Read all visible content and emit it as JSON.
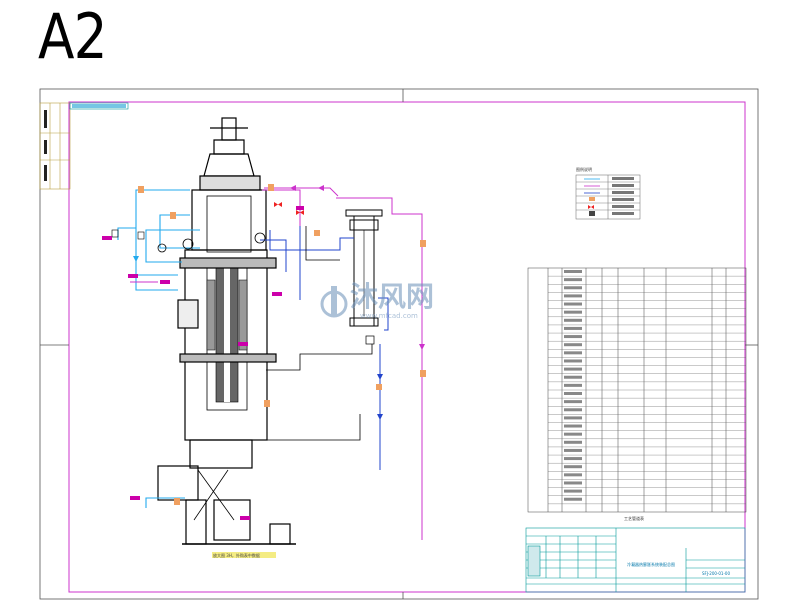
{
  "sheet": {
    "size_label": "A2"
  },
  "colors": {
    "border": "#cc33cc",
    "structure": "#000000",
    "pipe_cyan": "#22aaee",
    "pipe_magenta": "#cc33cc",
    "pipe_blue": "#2244cc",
    "valve_orange": "#f0a060",
    "tag_magenta": "#cc00aa",
    "valve_red": "#ee2222",
    "note_fill": "#f0e44e",
    "title_teal": "#009999"
  },
  "watermark": {
    "text": "沐风网",
    "url": "www.mfcad.com",
    "logo": "mfcad-logo"
  },
  "drawing_note": "放大图 3H，外购表中数据",
  "table_caption": "工艺管道表",
  "legend_title": "图例说明",
  "title_block": {
    "project": "冷凝器热膨胀系统装配总图",
    "drawing_no": "SFJ-200-01-00"
  }
}
